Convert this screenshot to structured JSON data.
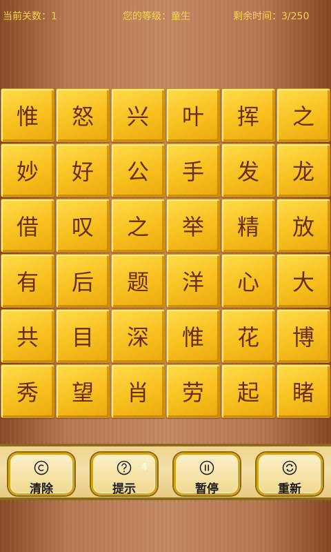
{
  "status": {
    "level": "当前关数：1",
    "rank": "您的等级：童生",
    "time": "剩余时间：3/250"
  },
  "tiles": [
    "惟",
    "怒",
    "兴",
    "叶",
    "挥",
    "之",
    "妙",
    "好",
    "公",
    "手",
    "发",
    "龙",
    "借",
    "叹",
    "之",
    "举",
    "精",
    "放",
    "有",
    "后",
    "题",
    "洋",
    "心",
    "大",
    "共",
    "目",
    "深",
    "惟",
    "花",
    "博",
    "秀",
    "望",
    "肖",
    "劳",
    "起",
    "睹"
  ],
  "buttons": {
    "clear": {
      "label": "清除",
      "icon": "copyright-icon"
    },
    "hint": {
      "label": "提示",
      "icon": "question-icon",
      "count": "4"
    },
    "pause": {
      "label": "暂停",
      "icon": "pause-icon"
    },
    "restart": {
      "label": "重新",
      "icon": "refresh-icon"
    }
  },
  "colors": {
    "status_text": "#f7d64a",
    "tile": "#f7c01f",
    "tile_text": "#6a2c12",
    "toolbar": "#f4e1a8"
  }
}
